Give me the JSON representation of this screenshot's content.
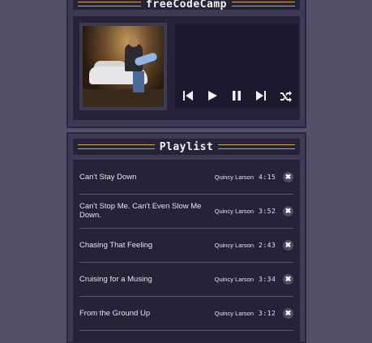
{
  "player": {
    "title": "freeCodeCamp",
    "controls": [
      {
        "name": "previous-icon"
      },
      {
        "name": "play-icon"
      },
      {
        "name": "pause-icon"
      },
      {
        "name": "next-icon"
      },
      {
        "name": "shuffle-icon"
      }
    ]
  },
  "playlist": {
    "title": "Playlist",
    "songs": [
      {
        "title": "Can't Stay Down",
        "artist": "Quincy Larson",
        "duration": "4:15"
      },
      {
        "title": "Can't Stop Me. Can't Even Slow Me Down.",
        "artist": "Quincy Larson",
        "duration": "3:52"
      },
      {
        "title": "Chasing That Feeling",
        "artist": "Quincy Larson",
        "duration": "2:43"
      },
      {
        "title": "Cruising for a Musing",
        "artist": "Quincy Larson",
        "duration": "3:34"
      },
      {
        "title": "From the Ground Up",
        "artist": "Quincy Larson",
        "duration": "3:12"
      }
    ],
    "delete_label": "✖"
  },
  "colors": {
    "background": "#535168",
    "panel": "#3c3a54",
    "inner": "#242338",
    "accent": "#d8a14a"
  }
}
